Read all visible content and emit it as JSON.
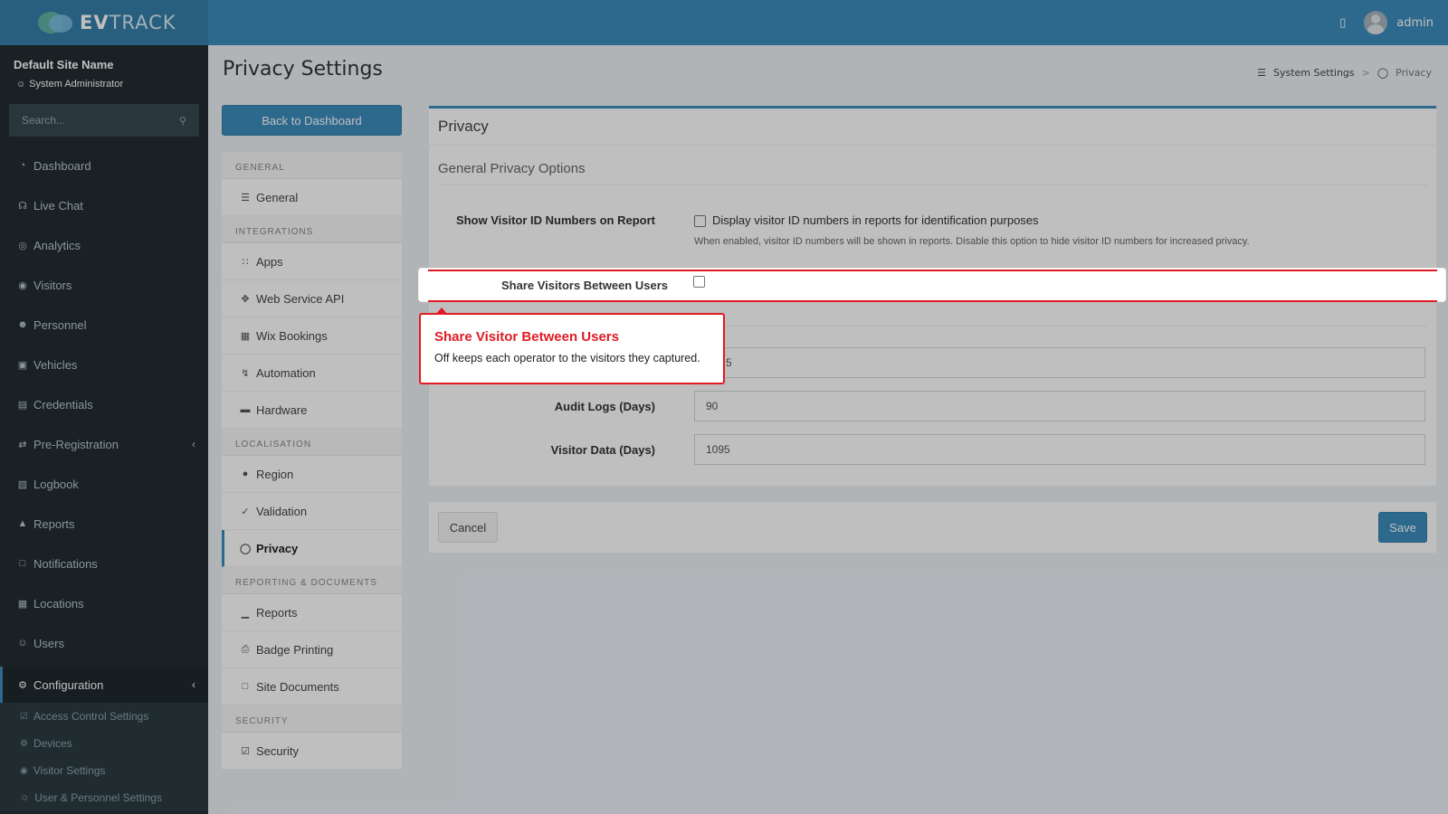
{
  "app": {
    "logo_bold": "EV",
    "logo_light": "TRACK",
    "user": "admin"
  },
  "sidebar": {
    "site_name": "Default Site Name",
    "role": "System Administrator",
    "search_placeholder": "Search...",
    "items": [
      {
        "label": "Dashboard",
        "icon": "dashboard-icon"
      },
      {
        "label": "Live Chat",
        "icon": "headset-icon"
      },
      {
        "label": "Analytics",
        "icon": "target-icon"
      },
      {
        "label": "Visitors",
        "icon": "eye-icon"
      },
      {
        "label": "Personnel",
        "icon": "personnel-icon"
      },
      {
        "label": "Vehicles",
        "icon": "car-icon"
      },
      {
        "label": "Credentials",
        "icon": "id-card-icon"
      },
      {
        "label": "Pre-Registration",
        "icon": "arrows-icon"
      },
      {
        "label": "Logbook",
        "icon": "book-icon"
      },
      {
        "label": "Reports",
        "icon": "chart-icon"
      },
      {
        "label": "Notifications",
        "icon": "chat-icon"
      },
      {
        "label": "Locations",
        "icon": "building-icon"
      },
      {
        "label": "Users",
        "icon": "users-icon"
      }
    ],
    "active_item": "Configuration",
    "sub_items": [
      {
        "label": "Access Control Settings"
      },
      {
        "label": "Devices"
      },
      {
        "label": "Visitor Settings"
      },
      {
        "label": "User & Personnel Settings"
      }
    ]
  },
  "page": {
    "title": "Privacy Settings",
    "breadcrumb": [
      "System Settings",
      "Privacy"
    ],
    "back_button": "Back to Dashboard"
  },
  "settings_nav": {
    "general_header": "GENERAL",
    "general": "General",
    "integrations_header": "INTEGRATIONS",
    "apps": "Apps",
    "web_service_api": "Web Service API",
    "wix_bookings": "Wix Bookings",
    "automation": "Automation",
    "hardware": "Hardware",
    "localisation_header": "LOCALISATION",
    "region": "Region",
    "validation": "Validation",
    "privacy": "Privacy",
    "reporting_header": "REPORTING & DOCUMENTS",
    "reports": "Reports",
    "badge_printing": "Badge Printing",
    "site_documents": "Site Documents",
    "security_header": "SECURITY",
    "security": "Security"
  },
  "panel": {
    "title": "Privacy",
    "section": "General Privacy Options",
    "show_visitor_id_label": "Show Visitor ID Numbers on Report",
    "show_visitor_id_checkbox": "Display visitor ID numbers in reports for identification purposes",
    "show_visitor_id_help": "When enabled, visitor ID numbers will be shown in reports. Disable this option to hide visitor ID numbers for increased privacy.",
    "share_visitors_label": "Share Visitors Between Users",
    "first_input_value_visible": "5",
    "audit_logs_label": "Audit Logs (Days)",
    "audit_logs_value": "90",
    "visitor_data_label": "Visitor Data (Days)",
    "visitor_data_value": "1095"
  },
  "footer": {
    "cancel": "Cancel",
    "save": "Save"
  },
  "tooltip": {
    "title": "Share Visitor Between Users",
    "body": "Off keeps each operator to the visitors they captured."
  },
  "colors": {
    "brand": "#3c8dbc",
    "sidebar": "#222d32",
    "highlight": "#e01b24"
  }
}
